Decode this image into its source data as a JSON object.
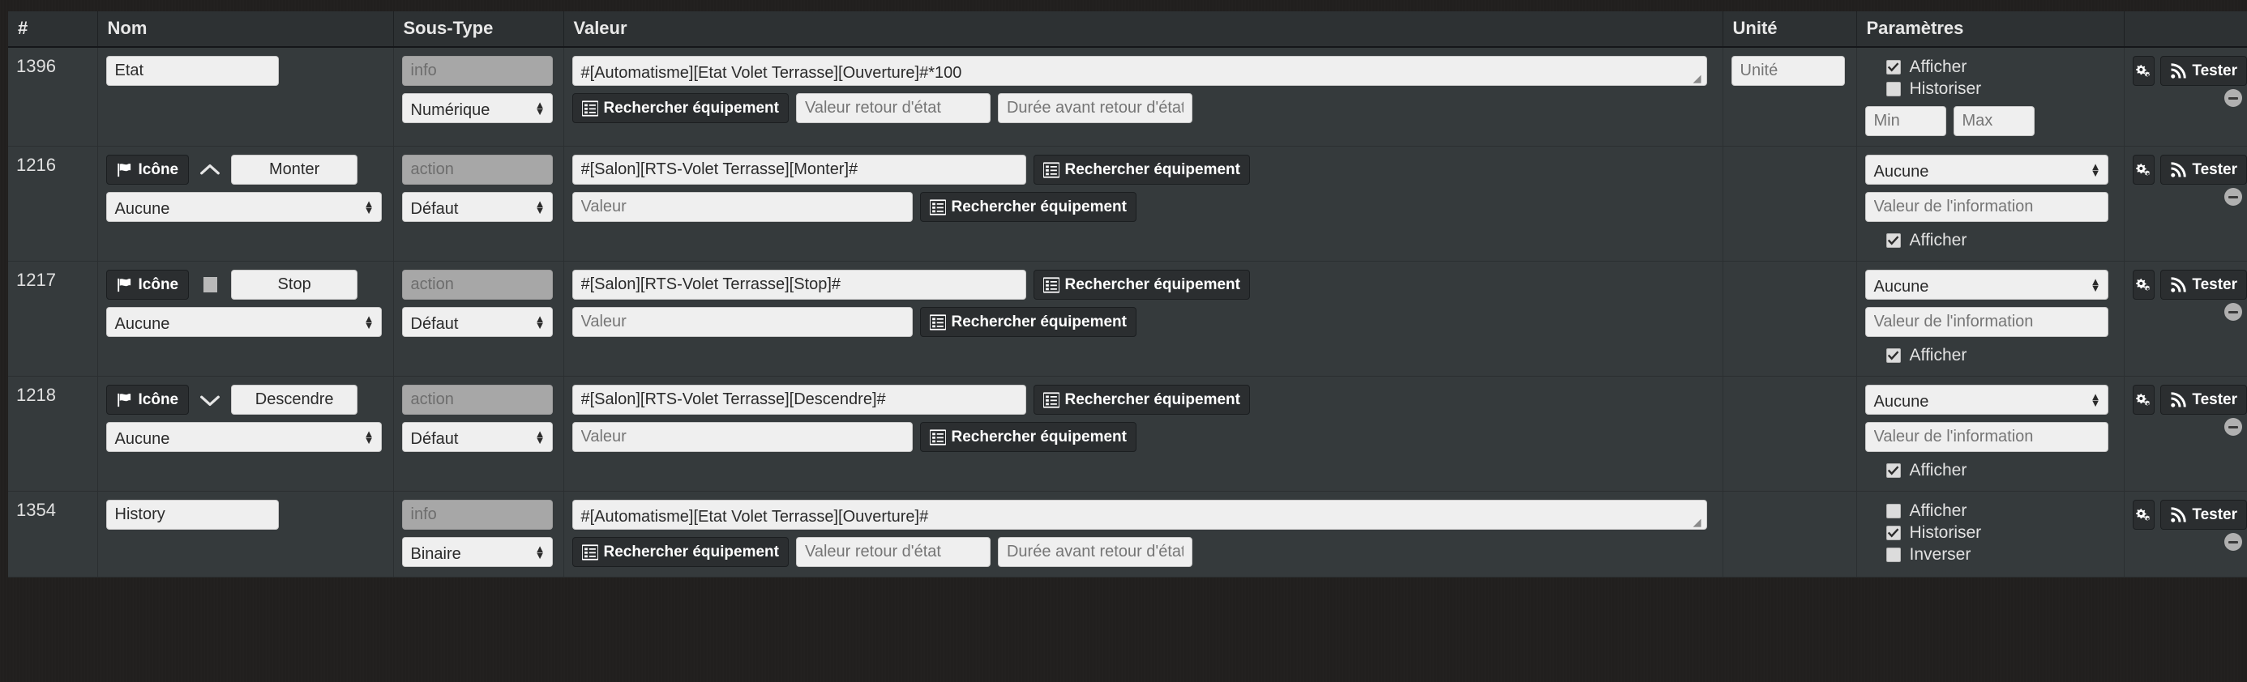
{
  "table": {
    "headers": [
      "#",
      "Nom",
      "Sous-Type",
      "Valeur",
      "Unité",
      "Paramètres",
      ""
    ]
  },
  "labels": {
    "icone_button": "Icône",
    "rechercher_equipement": "Rechercher équipement",
    "tester": "Tester",
    "afficher": "Afficher",
    "historiser": "Historiser",
    "inverser": "Inverser"
  },
  "placeholders": {
    "unite": "Unité",
    "min": "Min",
    "max": "Max",
    "valeur": "Valeur",
    "valeur_retour_etat": "Valeur retour d'état",
    "duree_avant_retour": "Durée avant retour d'état (min)",
    "valeur_information": "Valeur de l'information"
  },
  "rows": [
    {
      "id": "1396",
      "nom": "Etat",
      "type_tag": "info",
      "subtype": "Numérique",
      "valeur": "#[Automatisme][Etat Volet Terrasse][Ouverture]#*100",
      "unite_placeholder": "Unité",
      "params": {
        "afficher": true,
        "historiser": false,
        "min": "Min",
        "max": "Max"
      }
    },
    {
      "id": "1216",
      "icon_glyph": "chevron-up",
      "nom": "Monter",
      "type_tag": "action",
      "subtype": "Défaut",
      "unit_select": "Aucune",
      "valeur": "#[Salon][RTS-Volet Terrasse][Monter]#",
      "params": {
        "select": "Aucune",
        "info_value_placeholder": "Valeur de l'information",
        "afficher": true
      }
    },
    {
      "id": "1217",
      "icon_glyph": "square",
      "nom": "Stop",
      "type_tag": "action",
      "subtype": "Défaut",
      "unit_select": "Aucune",
      "valeur": "#[Salon][RTS-Volet Terrasse][Stop]#",
      "params": {
        "select": "Aucune",
        "info_value_placeholder": "Valeur de l'information",
        "afficher": true
      }
    },
    {
      "id": "1218",
      "icon_glyph": "chevron-down",
      "nom": "Descendre",
      "type_tag": "action",
      "subtype": "Défaut",
      "unit_select": "Aucune",
      "valeur": "#[Salon][RTS-Volet Terrasse][Descendre]#",
      "params": {
        "select": "Aucune",
        "info_value_placeholder": "Valeur de l'information",
        "afficher": true
      }
    },
    {
      "id": "1354",
      "nom": "History",
      "type_tag": "info",
      "subtype": "Binaire",
      "valeur": "#[Automatisme][Etat Volet Terrasse][Ouverture]#",
      "params": {
        "afficher": false,
        "historiser": true,
        "inverser": false
      }
    }
  ],
  "colors": {
    "table_row_bg": "#353a3c",
    "header_bg": "#2d3133",
    "input_bg": "#efefef",
    "disabled_bg": "#a7a7a7",
    "button_dark_bg": "#2b2e30",
    "page_bg": "#211f1e"
  }
}
